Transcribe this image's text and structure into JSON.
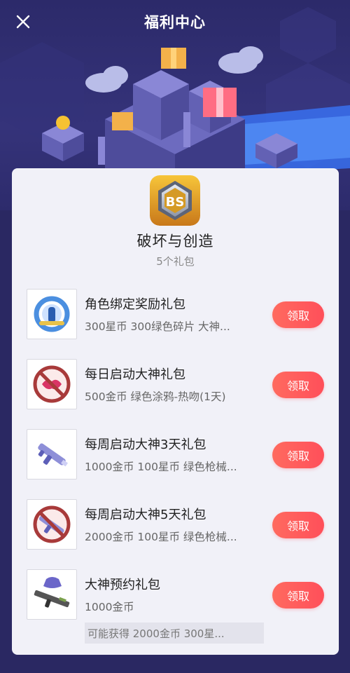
{
  "header": {
    "title": "福利中心",
    "close_icon": "close-icon"
  },
  "game": {
    "name": "破坏与创造",
    "pack_count": "5个礼包",
    "icon_text": "BS"
  },
  "gifts": [
    {
      "title": "角色绑定奖励礼包",
      "desc": "300星币 300绿色碎片 大神...",
      "button": "领取",
      "icon": "character-icon"
    },
    {
      "title": "每日启动大神礼包",
      "desc": "500金币 绿色涂鸦-热吻(1天)",
      "button": "领取",
      "icon": "kiss-graffiti-icon"
    },
    {
      "title": "每周启动大神3天礼包",
      "desc": "1000金币 100星币 绿色枪械...",
      "button": "领取",
      "icon": "gun-icon"
    },
    {
      "title": "每周启动大神5天礼包",
      "desc": "2000金币 100星币 绿色枪械...",
      "button": "领取",
      "icon": "gun-graffiti-icon"
    },
    {
      "title": "大神预约礼包",
      "desc": "1000金币",
      "extra": "可能获得 2000金币 300星...",
      "button": "领取",
      "icon": "weapon-bundle-icon"
    }
  ],
  "colors": {
    "background": "#2a2862",
    "accent": "#ff5a5f",
    "card": "#f1f1f8"
  }
}
